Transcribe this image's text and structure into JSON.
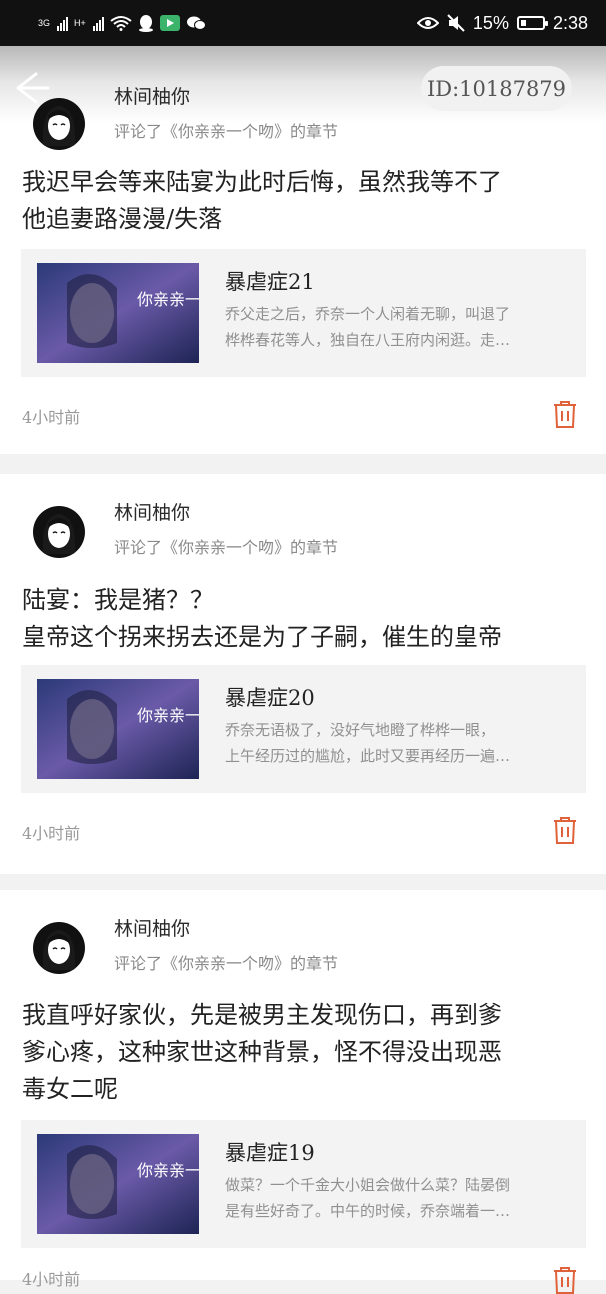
{
  "status_bar": {
    "net1": "3G",
    "net2": "H+",
    "battery": "15%",
    "time": "2:38"
  },
  "header": {
    "back_icon": "back-arrow-icon",
    "id_label": "ID:10187879"
  },
  "comments": [
    {
      "user": "林间柚你",
      "action": "评论了《你亲亲一个吻》的章节",
      "text_lines": [
        "我迟早会等来陆宴为此时后悔，虽然我等不了",
        "他追妻路漫漫/失落"
      ],
      "chapter": {
        "title": "暴虐症21",
        "excerpt": [
          "乔父走之后，乔奈一个人闲着无聊，叫退了",
          "桦桦春花等人，独自在八王府内闲逛。走…"
        ],
        "cover_title": "你亲亲一个吻"
      },
      "time": "4小时前"
    },
    {
      "user": "林间柚你",
      "action": "评论了《你亲亲一个吻》的章节",
      "text_lines": [
        "陆宴：我是猪？？",
        "皇帝这个拐来拐去还是为了子嗣，催生的皇帝"
      ],
      "chapter": {
        "title": "暴虐症20",
        "excerpt": [
          "乔奈无语极了，没好气地瞪了桦桦一眼，",
          "上午经历过的尴尬，此时又要再经历一遍…"
        ],
        "cover_title": "你亲亲一个吻"
      },
      "time": "4小时前"
    },
    {
      "user": "林间柚你",
      "action": "评论了《你亲亲一个吻》的章节",
      "text_lines": [
        "我直呼好家伙，先是被男主发现伤口，再到爹",
        "爹心疼，这种家世这种背景，怪不得没出现恶",
        "毒女二呢"
      ],
      "chapter": {
        "title": "暴虐症19",
        "excerpt": [
          "做菜？一个千金大小姐会做什么菜？陆晏倒",
          "是有些好奇了。中午的时候，乔奈端着一…"
        ],
        "cover_title": "你亲亲一个吻"
      },
      "time": "4小时前"
    }
  ],
  "colors": {
    "accent_red": "#e0623a",
    "card_bg": "#ffffff",
    "page_bg": "#f2f2f2"
  }
}
